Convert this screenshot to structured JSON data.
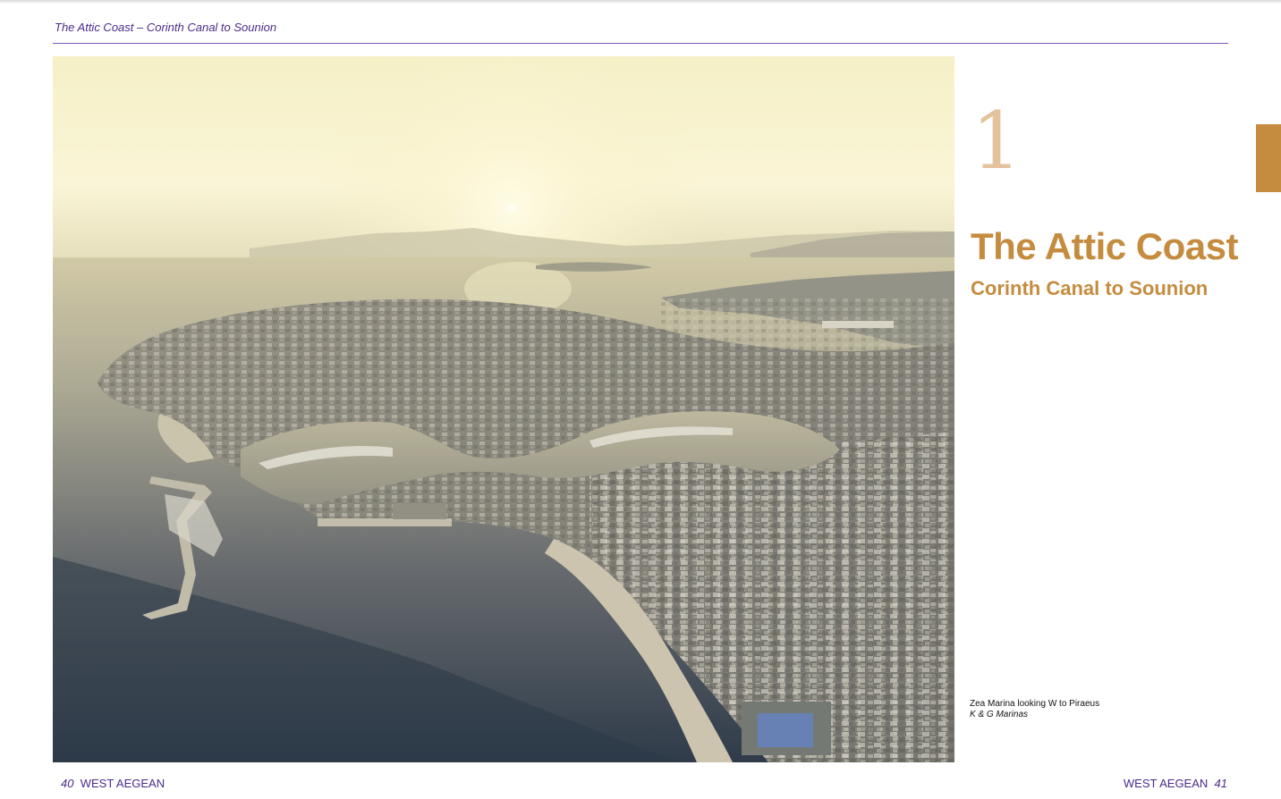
{
  "running_head": "The Attic Coast – Corinth Canal to Sounion",
  "chapter": {
    "number": "1",
    "title": "The Attic Coast",
    "subtitle": "Corinth Canal to Sounion"
  },
  "photo": {
    "caption": "Zea Marina looking W to Piraeus",
    "credit": "K & G Marinas"
  },
  "footer": {
    "left_page_number": "40",
    "left_book_title": "WEST AEGEAN",
    "right_book_title": "WEST AEGEAN",
    "right_page_number": "41"
  },
  "colors": {
    "accent_purple": "#4b2a8a",
    "chapter_orange": "#c58c3f",
    "chapter_number_tint": "#e4c39c"
  }
}
